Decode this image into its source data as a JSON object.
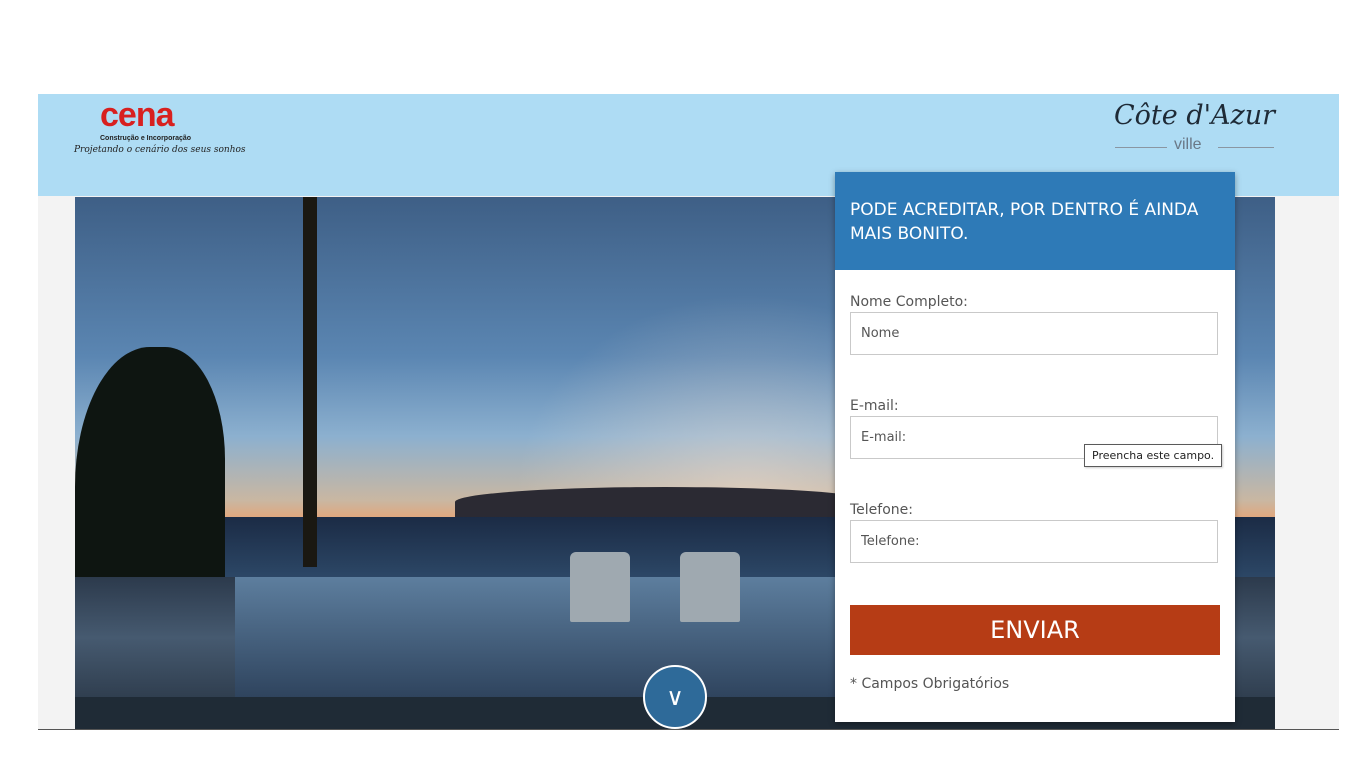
{
  "header": {
    "cena_logo": {
      "brand": "cena",
      "subtitle": "Construção e Incorporação",
      "tagline": "Projetando o cenário dos seus sonhos"
    },
    "cote_logo": {
      "script": "Côte d'Azur",
      "sub": "ville"
    }
  },
  "form": {
    "title": "PODE ACREDITAR, POR DENTRO É AINDA MAIS BONITO.",
    "name_label": "Nome Completo:",
    "name_placeholder": "Nome",
    "email_label": "E-mail:",
    "email_placeholder": "E-mail:",
    "phone_label": "Telefone:",
    "phone_placeholder": "Telefone:",
    "tooltip": "Preencha este campo.",
    "submit_label": "ENVIAR",
    "required_note": "* Campos Obrigatórios"
  },
  "hero": {
    "scroll_icon": "chevron-down-icon",
    "scroll_glyph": "∨"
  },
  "colors": {
    "header_bg": "#aedcf4",
    "form_head": "#2e7ab7",
    "submit": "#b63c15",
    "brand_red": "#d8201f"
  }
}
